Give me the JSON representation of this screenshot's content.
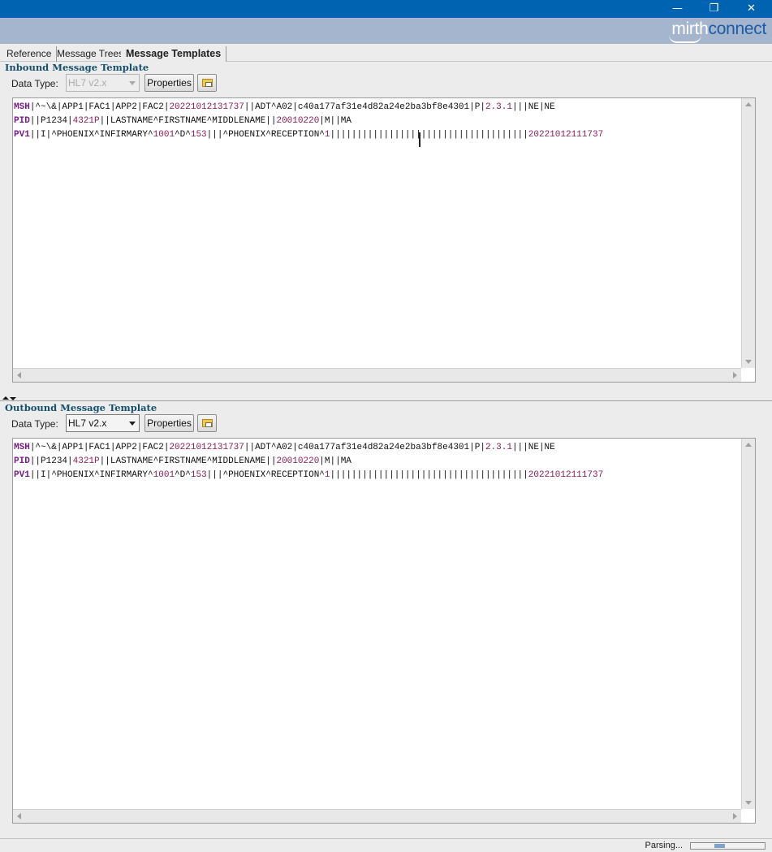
{
  "window": {
    "minimize_glyph": "—",
    "restore_glyph": "❐",
    "close_glyph": "✕"
  },
  "brand": {
    "part1": "mirth",
    "part2": "connect"
  },
  "tabs": [
    {
      "label": "Reference",
      "active": false
    },
    {
      "label": "Message Trees",
      "active": false
    },
    {
      "label": "Message Templates",
      "active": true
    }
  ],
  "inbound": {
    "title": "Inbound Message Template",
    "data_type_label": "Data Type:",
    "data_type_value": "HL7 v2.x",
    "data_type_enabled": false,
    "properties_label": "Properties",
    "open_icon": "open-file-icon",
    "lines": [
      [
        [
          "seg",
          "MSH"
        ],
        [
          "t",
          "|^~\\&|APP1|FAC1|APP2|FAC2|"
        ],
        [
          "num",
          "20221012131737"
        ],
        [
          "t",
          "||ADT^A02|c40a177af31e4d82a24e2ba3bf8e4301|P|"
        ],
        [
          "num",
          "2.3.1"
        ],
        [
          "t",
          "|||NE|NE"
        ]
      ],
      [
        [
          "seg",
          "PID"
        ],
        [
          "t",
          "||P1234|"
        ],
        [
          "num",
          "4321P"
        ],
        [
          "t",
          "||LASTNAME^FIRSTNAME^MIDDLENAME||"
        ],
        [
          "num",
          "20010220"
        ],
        [
          "t",
          "|M||MA"
        ]
      ],
      [
        [
          "seg",
          "PV1"
        ],
        [
          "t",
          "||I|^PHOENIX^INFIRMARY^"
        ],
        [
          "num",
          "1001"
        ],
        [
          "t",
          "^D^"
        ],
        [
          "num",
          "153"
        ],
        [
          "t",
          "|||^PHOENIX^RECEPTION^"
        ],
        [
          "num",
          "1"
        ],
        [
          "t",
          "|||||||||||||||||||||||||||||||||||||"
        ],
        [
          "num",
          "20221012111737"
        ]
      ]
    ]
  },
  "outbound": {
    "title": "Outbound Message Template",
    "data_type_label": "Data Type:",
    "data_type_value": "HL7 v2.x",
    "data_type_enabled": true,
    "properties_label": "Properties",
    "open_icon": "open-file-icon",
    "lines": [
      [
        [
          "seg",
          "MSH"
        ],
        [
          "t",
          "|^~\\&|APP1|FAC1|APP2|FAC2|"
        ],
        [
          "num",
          "20221012131737"
        ],
        [
          "t",
          "||ADT^A02|c40a177af31e4d82a24e2ba3bf8e4301|P|"
        ],
        [
          "num",
          "2.3.1"
        ],
        [
          "t",
          "|||NE|NE"
        ]
      ],
      [
        [
          "seg",
          "PID"
        ],
        [
          "t",
          "||P1234|"
        ],
        [
          "num",
          "4321P"
        ],
        [
          "t",
          "||LASTNAME^FIRSTNAME^MIDDLENAME||"
        ],
        [
          "num",
          "20010220"
        ],
        [
          "t",
          "|M||MA"
        ]
      ],
      [
        [
          "seg",
          "PV1"
        ],
        [
          "t",
          "||I|^PHOENIX^INFIRMARY^"
        ],
        [
          "num",
          "1001"
        ],
        [
          "t",
          "^D^"
        ],
        [
          "num",
          "153"
        ],
        [
          "t",
          "|||^PHOENIX^RECEPTION^"
        ],
        [
          "num",
          "1"
        ],
        [
          "t",
          "|||||||||||||||||||||||||||||||||||||"
        ],
        [
          "num",
          "20221012111737"
        ]
      ]
    ]
  },
  "status": {
    "text": "Parsing...",
    "progress_fraction_start": 0.32,
    "progress_fraction_width": 0.14
  },
  "colors": {
    "titlebar": "#0063b1",
    "brandbar": "#a5b5cd",
    "segment": "#7a1a8a",
    "number": "#8b1d5a"
  }
}
